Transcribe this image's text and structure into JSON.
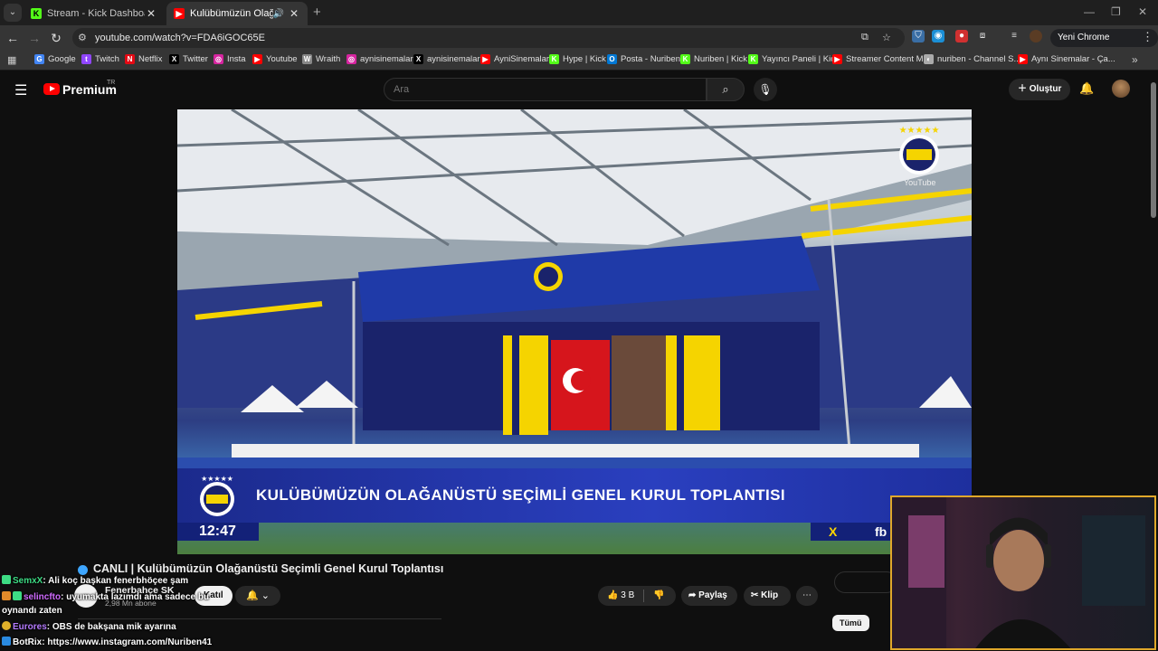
{
  "browser": {
    "tabs": [
      {
        "title": "Stream - Kick Dashboard",
        "favicon": "kick-icon",
        "active": false
      },
      {
        "title": "Kulübümüzün Olağanüstü S",
        "favicon": "youtube-icon",
        "active": true
      }
    ],
    "address": "youtube.com/watch?v=FDA6iGOC65E",
    "profile_label": "Yeni Chrome kullanılabilir",
    "bookmarks": [
      {
        "label": "Google",
        "icon": "google-icon",
        "color": "#4285f4"
      },
      {
        "label": "Twitch",
        "icon": "twitch-icon",
        "color": "#9146ff"
      },
      {
        "label": "Netflix",
        "icon": "netflix-icon",
        "color": "#e50914"
      },
      {
        "label": "Twitter",
        "icon": "x-icon",
        "color": "#000000"
      },
      {
        "label": "Insta",
        "icon": "instagram-icon",
        "color": "#d6249f"
      },
      {
        "label": "Youtube",
        "icon": "youtube-icon",
        "color": "#ff0000"
      },
      {
        "label": "Wraith",
        "icon": "wraith-icon",
        "color": "#888888"
      },
      {
        "label": "aynisinemalar",
        "icon": "instagram-icon",
        "color": "#d6249f"
      },
      {
        "label": "aynisinemalar",
        "icon": "x-icon",
        "color": "#000000"
      },
      {
        "label": "AyniSinemalar",
        "icon": "youtube-icon",
        "color": "#ff0000"
      },
      {
        "label": "Hype | Kick",
        "icon": "kick-icon",
        "color": "#53fc18"
      },
      {
        "label": "Posta - Nuriben",
        "icon": "outlook-icon",
        "color": "#0078d4"
      },
      {
        "label": "Nuriben | Kick",
        "icon": "kick-icon",
        "color": "#53fc18"
      },
      {
        "label": "Yayıncı Paneli | Kick",
        "icon": "kick-icon",
        "color": "#53fc18"
      },
      {
        "label": "Streamer Content M...",
        "icon": "youtube-icon",
        "color": "#ff0000"
      },
      {
        "label": "nuriben - Channel S...",
        "icon": "studio-icon",
        "color": "#aaaaaa"
      },
      {
        "label": "Aynı Sinemalar - Ça...",
        "icon": "youtube-icon",
        "color": "#ff0000"
      }
    ]
  },
  "youtube": {
    "brand": "Premium",
    "region": "TR",
    "search_placeholder": "Ara",
    "create_label": "Oluştur"
  },
  "video": {
    "lower_third_title": "KULÜBÜMÜZÜN OLAĞANÜSTÜ SEÇİMLİ GENEL KURUL TOPLANTISI",
    "clock": "12:47",
    "corner_x": "X",
    "corner_fb": "fb",
    "watermark": "YouTube",
    "title": "CANLI | Kulübümüzün Olağanüstü Seçimli Genel Kurul Toplantısı",
    "channel_name": "Fenerbahçe SK",
    "channel_subs": "2,98 Mn abone",
    "join_label": "Katıl",
    "likes": "3 B",
    "share_label": "Paylaş",
    "clip_label": "Klip",
    "sort_chip": "Tümü"
  },
  "chat": [
    {
      "user": "SemxX",
      "color": "#3ddc84",
      "text": ": Ali koç başkan fenerbhöçee şam"
    },
    {
      "user": "selincfto",
      "color": "#d06bff",
      "text": ": uyumakta lazımdı ama sadece bu"
    },
    {
      "user": "",
      "color": "#ffffff",
      "text": "oynandı zaten"
    },
    {
      "user": "Eurores",
      "color": "#b57bff",
      "text": ": OBS de bakşana mik ayarına"
    },
    {
      "user": "BotRix",
      "color": "#ffffff",
      "text": ": https://www.instagram.com/Nuriben41"
    }
  ]
}
